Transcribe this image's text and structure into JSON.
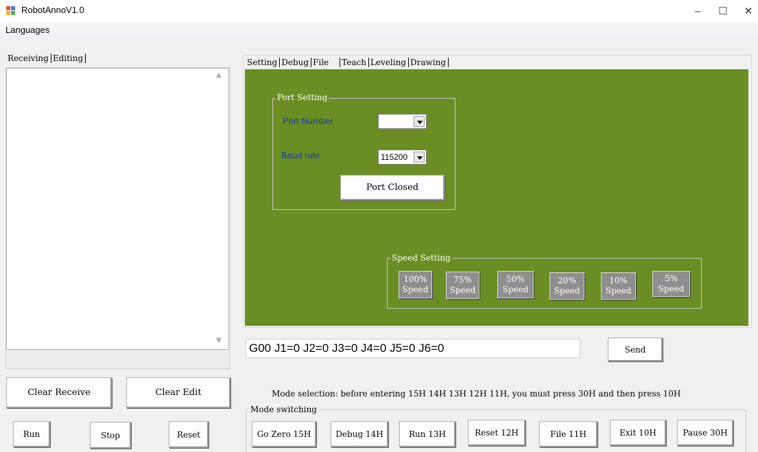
{
  "window": {
    "title": "RobotAnnoV1.0",
    "minimize": "–",
    "maximize": "☐",
    "close": "✕"
  },
  "menu": {
    "languages": "Languages"
  },
  "left_tabs": [
    "Receiving",
    "Editing"
  ],
  "right_tabs": [
    "Setting",
    "Debug",
    "File",
    "Teach",
    "Leveling",
    "Drawing"
  ],
  "receive_box": {
    "value": ""
  },
  "port_setting": {
    "title": "Port Setting",
    "port_number_label": "Port Number",
    "port_number_value": "",
    "baud_rate_label": "Baud rate",
    "baud_rate_value": "115200",
    "port_button": "Port Closed"
  },
  "speed_setting": {
    "title": "Speed Setting",
    "buttons": [
      {
        "pct": "100%",
        "word": "Speed"
      },
      {
        "pct": "75%",
        "word": "Speed"
      },
      {
        "pct": "50%",
        "word": "Speed"
      },
      {
        "pct": "20%",
        "word": "Speed"
      },
      {
        "pct": "10%",
        "word": "Speed"
      },
      {
        "pct": "5%",
        "word": "Speed"
      }
    ]
  },
  "command": {
    "value": "G00 J1=0 J2=0 J3=0 J4=0 J5=0 J6=0",
    "send": "Send"
  },
  "left_buttons": {
    "clear_receive": "Clear Receive",
    "clear_edit": "Clear Edit",
    "run": "Run",
    "stop": "Stop",
    "reset": "Reset"
  },
  "mode": {
    "note": "Mode selection: before entering 15H 14H 13H 12H 11H, you must press 30H and then press 10H",
    "group_title": "Mode switching",
    "buttons": [
      "Go Zero 15H",
      "Debug 14H",
      "Run 13H",
      "Reset 12H",
      "File 11H",
      "Exit 10H",
      "Pause 30H"
    ]
  },
  "colors": {
    "panel_green": "#6a8e23",
    "label_blue": "#1a3aa8",
    "speed_button": "#8f8f8f"
  }
}
